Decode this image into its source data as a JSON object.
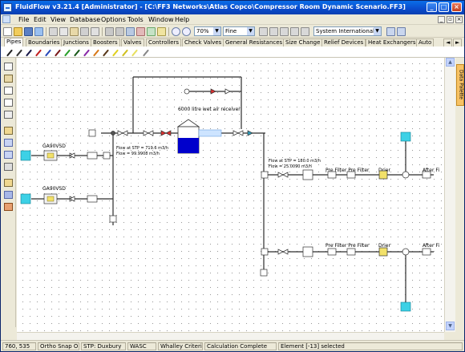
{
  "window": {
    "title": "FluidFlow v3.21.4 [Administrator] - [C:\\FF3 Networks\\Atlas Copco\\Compressor Room Dynamic Scenario.FF3]",
    "controls": {
      "minimize": "_",
      "maximize": "□",
      "close": "×"
    }
  },
  "menu": {
    "items": [
      "File",
      "Edit",
      "View",
      "Database",
      "Options",
      "Tools",
      "Window",
      "Help"
    ]
  },
  "toolbar": {
    "zoom": "70%",
    "resolution": "Fine",
    "units": "System International"
  },
  "tabs": [
    "Pipes",
    "Boundaries",
    "Junctions",
    "Boosters",
    "Valves",
    "Controllers",
    "Check Valves",
    "General Resistances",
    "Size Change",
    "Relief Devices",
    "Heat Exchangers",
    "Auto"
  ],
  "side_panel": {
    "label": "Data Palette"
  },
  "diagram": {
    "labels": {
      "receiver": "6000 litre wet air receiver",
      "vsd_top": "GA90VSD",
      "vsd_bottom": "GA90VSD",
      "flow_left_1": "Flow at STP = 719.6 m3/h",
      "flow_left_2": "Flow = 99.9908 m3/h",
      "flow_right_1": "Flow at STP = 180.0 m3/h",
      "flow_right_2": "Flow = 25.0090 m3/h",
      "prefilter_top": "Pre Filter Pre Filter",
      "drier_top": "Drier",
      "after_top": "After Fi",
      "prefilter_bottom": "Pre Filter Pre Filter",
      "drier_bottom": "Drier",
      "after_bottom": "After Fi"
    },
    "colors": {
      "pipe": "#2c2c2c",
      "tank_liquid": "#0000cc",
      "boundary": "#3dd1e6",
      "drier": "#f2e16a"
    }
  },
  "status": {
    "coords": "760, 535",
    "snap": "Ortho Snap ON",
    "stp": "STP: Duxbury",
    "fluid": "WASC",
    "criteria": "Whalley Criteria",
    "calc": "Calculation Complete",
    "selection": "Element [-13] selected"
  }
}
